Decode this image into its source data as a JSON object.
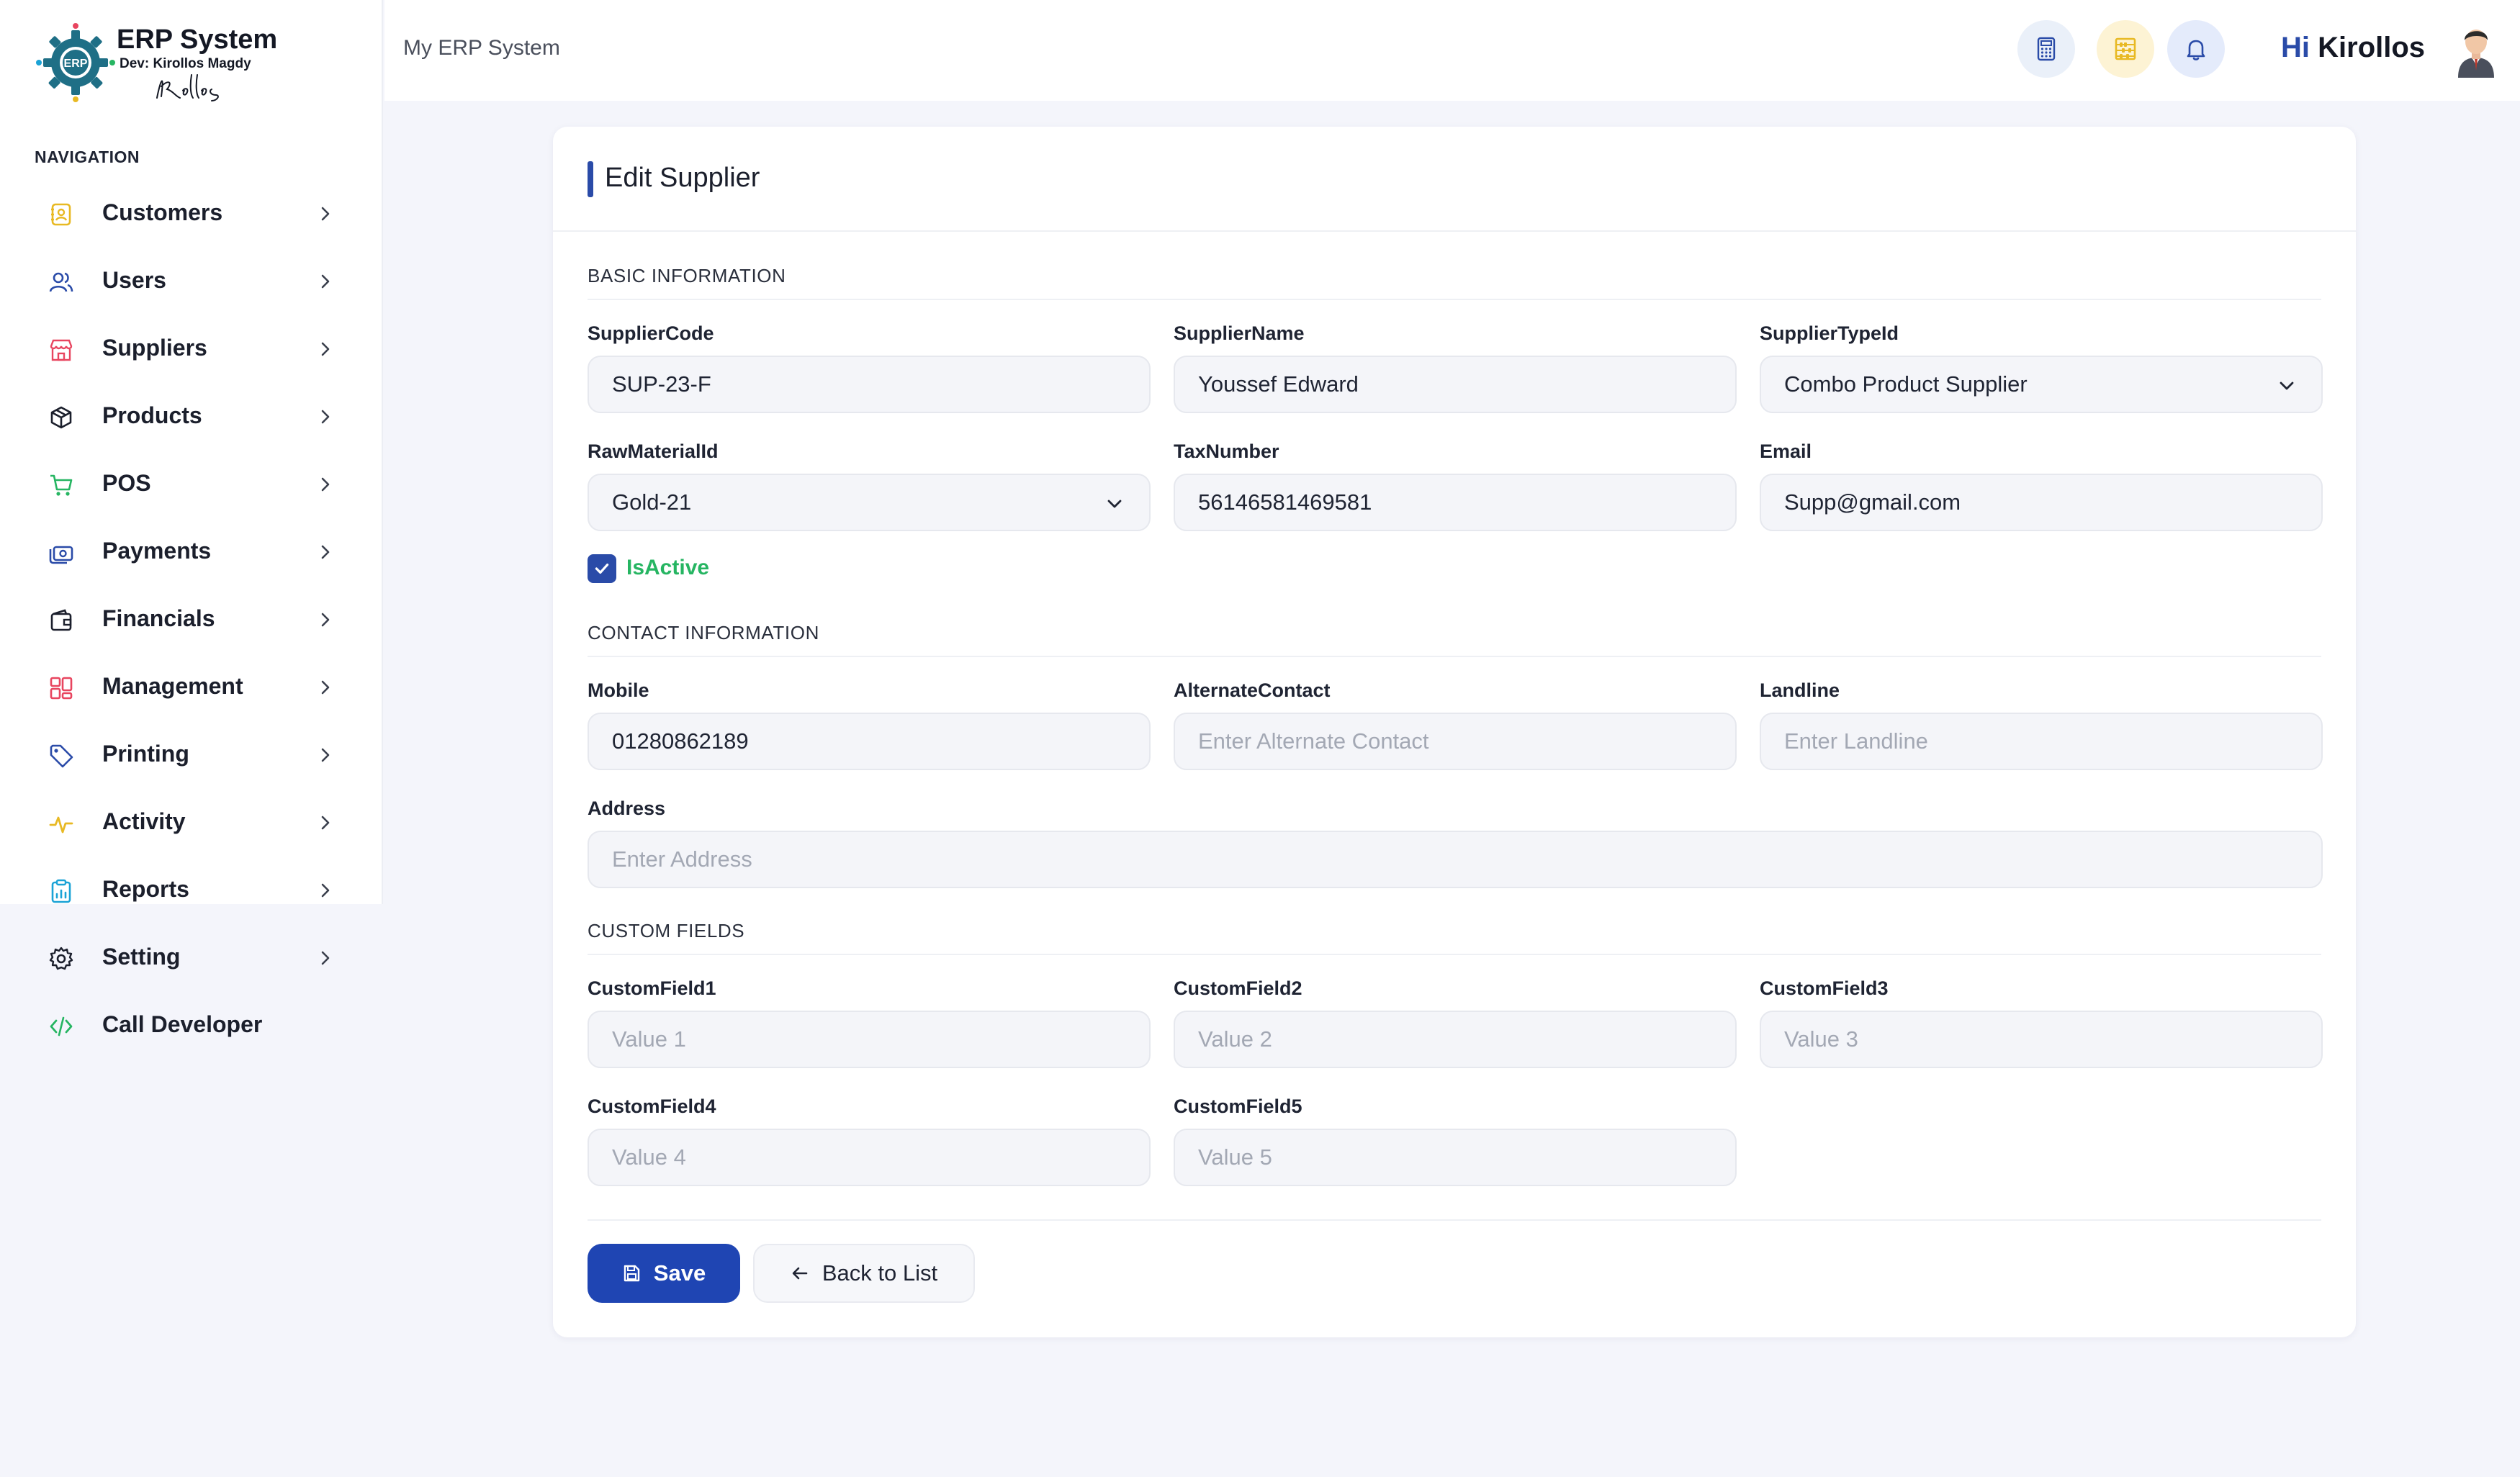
{
  "brand": {
    "title": "ERP System",
    "dev": "Dev: Kirollos Magdy",
    "signature": "Kirollos",
    "logo_text": "ERP"
  },
  "header": {
    "app_title": "My ERP System",
    "greeting_hi": "Hi",
    "user_name": "Kirollos"
  },
  "sidebar": {
    "heading": "NAVIGATION",
    "items": [
      {
        "label": "Customers",
        "icon": "contact-book-icon",
        "color": "#e8b923"
      },
      {
        "label": "Users",
        "icon": "users-icon",
        "color": "#2a4ba8"
      },
      {
        "label": "Suppliers",
        "icon": "store-icon",
        "color": "#e8455f"
      },
      {
        "label": "Products",
        "icon": "box-icon",
        "color": "#1b1f2c"
      },
      {
        "label": "POS",
        "icon": "cart-icon",
        "color": "#26b562"
      },
      {
        "label": "Payments",
        "icon": "money-icon",
        "color": "#2a4ba8"
      },
      {
        "label": "Financials",
        "icon": "wallet-icon",
        "color": "#1b1f2c"
      },
      {
        "label": "Management",
        "icon": "grid-icon",
        "color": "#e8455f"
      },
      {
        "label": "Printing",
        "icon": "tag-icon",
        "color": "#2a4ba8"
      },
      {
        "label": "Activity",
        "icon": "pulse-icon",
        "color": "#e8b923"
      },
      {
        "label": "Reports",
        "icon": "clipboard-icon",
        "color": "#1ba3d6"
      },
      {
        "label": "Setting",
        "icon": "gear-icon",
        "color": "#1b1f2c"
      },
      {
        "label": "Call Developer",
        "icon": "code-icon",
        "color": "#26b562"
      }
    ]
  },
  "form": {
    "title": "Edit Supplier",
    "sections": {
      "basic": "BASIC INFORMATION",
      "contact": "CONTACT INFORMATION",
      "custom": "CUSTOM FIELDS"
    },
    "fields": {
      "supplier_code": {
        "label": "SupplierCode",
        "value": "SUP-23-F"
      },
      "supplier_name": {
        "label": "SupplierName",
        "value": "Youssef Edward"
      },
      "supplier_type": {
        "label": "SupplierTypeId",
        "value": "Combo Product Supplier"
      },
      "raw_material": {
        "label": "RawMaterialId",
        "value": "Gold-21"
      },
      "tax_number": {
        "label": "TaxNumber",
        "value": "56146581469581"
      },
      "email": {
        "label": "Email",
        "value": "Supp@gmail.com"
      },
      "is_active": {
        "label": "IsActive",
        "checked": true
      },
      "mobile": {
        "label": "Mobile",
        "value": "01280862189"
      },
      "alternate_contact": {
        "label": "AlternateContact",
        "placeholder": "Enter Alternate Contact"
      },
      "landline": {
        "label": "Landline",
        "placeholder": "Enter Landline"
      },
      "address": {
        "label": "Address",
        "placeholder": "Enter Address"
      },
      "custom1": {
        "label": "CustomField1",
        "placeholder": "Value 1"
      },
      "custom2": {
        "label": "CustomField2",
        "placeholder": "Value 2"
      },
      "custom3": {
        "label": "CustomField3",
        "placeholder": "Value 3"
      },
      "custom4": {
        "label": "CustomField4",
        "placeholder": "Value 4"
      },
      "custom5": {
        "label": "CustomField5",
        "placeholder": "Value 5"
      }
    },
    "buttons": {
      "save": "Save",
      "back": "Back to List"
    }
  },
  "colors": {
    "accent": "#2a4ba8",
    "save_button": "#1f45b3",
    "active_green": "#26b562"
  }
}
